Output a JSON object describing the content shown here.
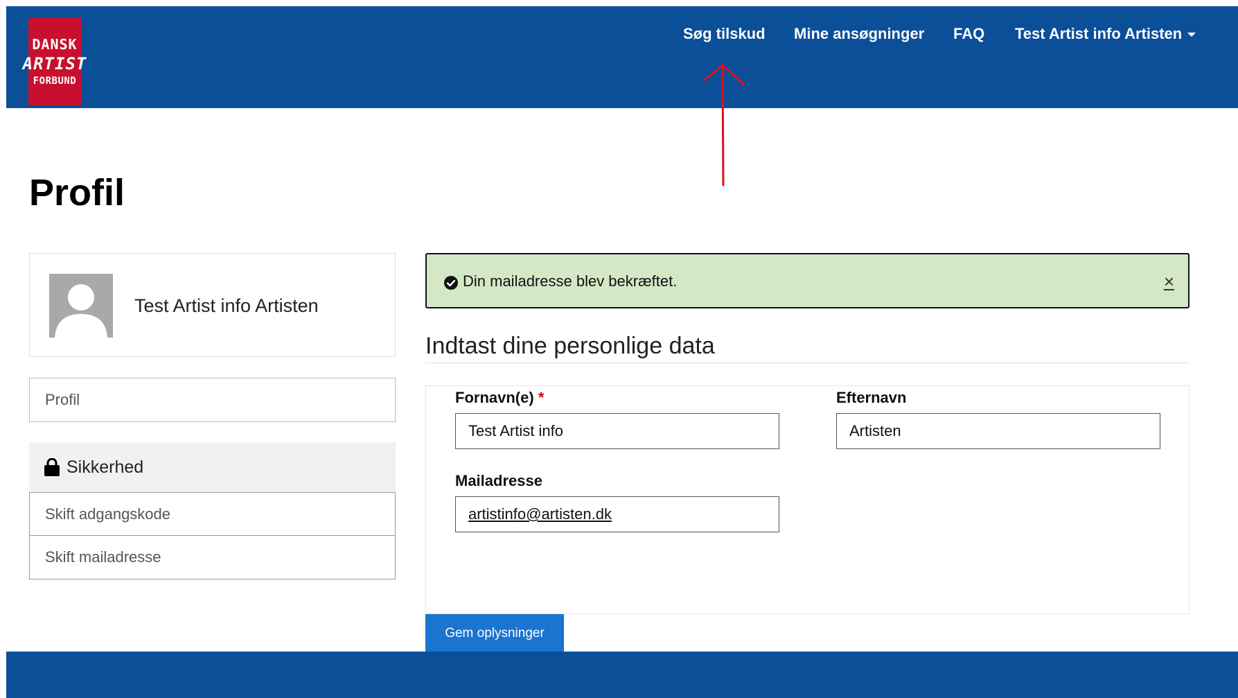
{
  "logo": {
    "line1": "DANSK",
    "line2": "ARTIST",
    "line3": "FORBUND"
  },
  "nav": {
    "items": [
      {
        "label": "Søg tilskud"
      },
      {
        "label": "Mine ansøgninger"
      },
      {
        "label": "FAQ"
      },
      {
        "label": "Test Artist info Artisten"
      }
    ]
  },
  "page": {
    "title": "Profil"
  },
  "user": {
    "name": "Test Artist info Artisten"
  },
  "sidebar": {
    "profil_label": "Profil",
    "security": {
      "heading": "Sikkerhed",
      "items": [
        {
          "label": "Skift adgangskode"
        },
        {
          "label": "Skift mailadresse"
        }
      ]
    }
  },
  "alert": {
    "message": "Din mailadresse blev bekræftet.",
    "close": "×"
  },
  "form": {
    "heading": "Indtast dine personlige data",
    "firstname_label": "Fornavn(e)",
    "required_mark": "*",
    "firstname_value": "Test Artist info",
    "lastname_label": "Efternavn",
    "lastname_value": "Artisten",
    "email_label": "Mailadresse",
    "email_value": "artistinfo@artisten.dk",
    "save_label": "Gem oplysninger"
  },
  "colors": {
    "header": "#0b4f99",
    "logo": "#c8102e",
    "alert_bg": "#d4e8c6",
    "button": "#1a74d0",
    "annotation": "#e0101e"
  }
}
